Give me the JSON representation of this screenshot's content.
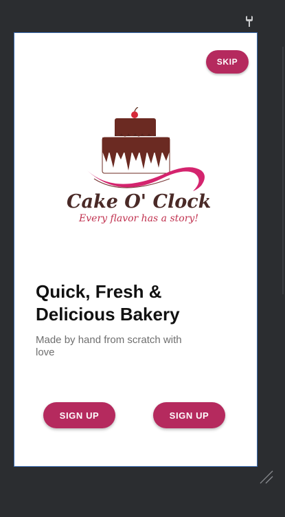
{
  "colors": {
    "accent": "#b52a5e",
    "background": "#2b2d30",
    "screen": "#ffffff",
    "frame_border": "#3d6fb6"
  },
  "icons": {
    "toolbar": "wrench-icon",
    "resize": "resize-handle-icon",
    "logo": "cake-logo"
  },
  "screen": {
    "skip_label": "SKIP",
    "logo": {
      "brand": "Cake O' Clock",
      "tagline": "Every flavor has a story!"
    },
    "headline": {
      "line1": "Quick, Fresh &",
      "line2": "Delicious Bakery"
    },
    "subtitle": "Made by hand from scratch with love",
    "buttons": {
      "left_label": "SIGN UP",
      "right_label": "SIGN UP"
    }
  }
}
